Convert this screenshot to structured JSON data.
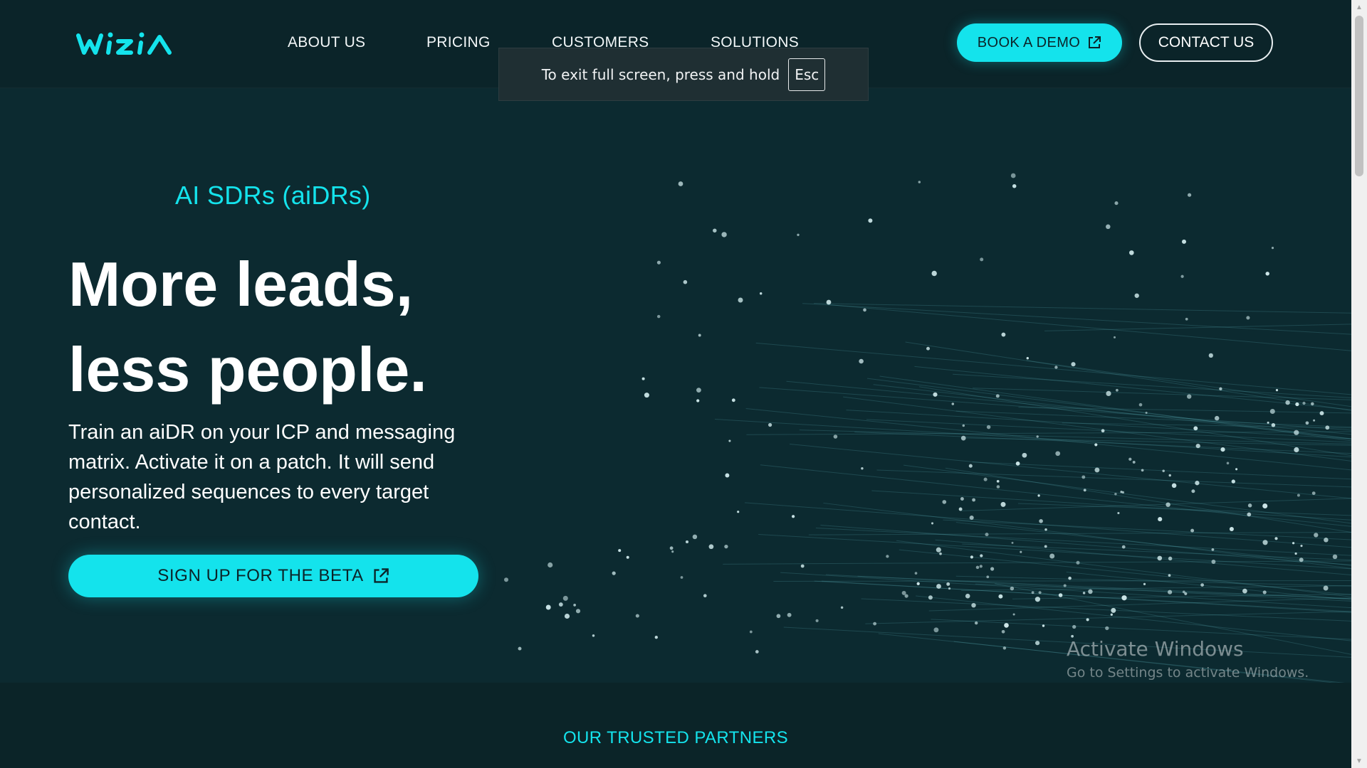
{
  "brand": {
    "logo_text": "wizia",
    "accent": "#14e3ec",
    "background": "#0c2a30"
  },
  "nav": {
    "items": [
      {
        "label": "ABOUT US"
      },
      {
        "label": "PRICING"
      },
      {
        "label": "CUSTOMERS"
      },
      {
        "label": "SOLUTIONS"
      }
    ],
    "book_demo_label": "BOOK A DEMO",
    "book_demo_icon": "external-link-icon",
    "contact_label": "CONTACT US"
  },
  "fullscreen_toast": {
    "text": "To exit full screen, press and hold",
    "key": "Esc"
  },
  "hero": {
    "eyebrow": "AI SDRs (aiDRs)",
    "headline_line1": "More leads,",
    "headline_line2": "less people.",
    "subtext": "Train an aiDR on your ICP and messaging matrix. Activate it on a patch. It will send personalized sequences to every target contact.",
    "cta_label": "SIGN UP FOR THE BETA",
    "cta_icon": "external-link-icon"
  },
  "partners": {
    "title": "OUR TRUSTED PARTNERS"
  },
  "windows_watermark": {
    "title": "Activate Windows",
    "subtitle": "Go to Settings to activate Windows."
  }
}
